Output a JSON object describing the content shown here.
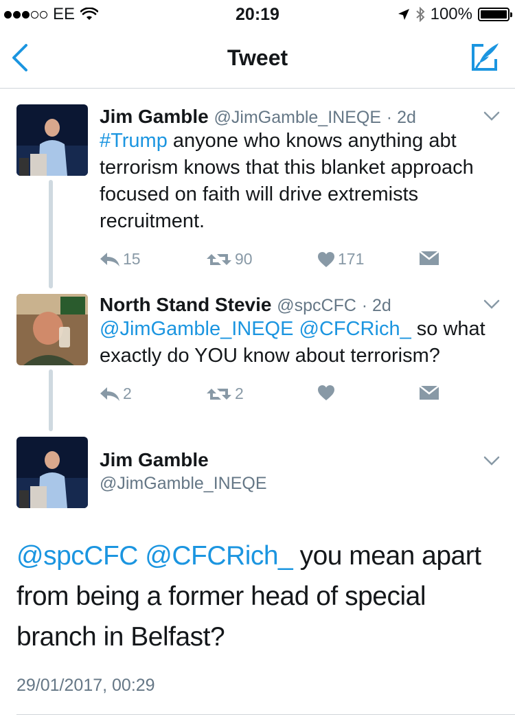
{
  "status_bar": {
    "carrier": "EE",
    "time": "20:19",
    "battery": "100%",
    "signal_bars_filled": 3,
    "signal_bars_total": 5
  },
  "nav": {
    "title": "Tweet"
  },
  "tweets": [
    {
      "name": "Jim Gamble",
      "handle": "@JimGamble_INEQE",
      "time": "· 2d",
      "text_parts": [
        {
          "text": "#Trump",
          "link": true
        },
        {
          "text": " anyone who knows anything abt terrorism knows that this blanket approach focused on faith will drive extremists recruitment.",
          "link": false
        }
      ],
      "replies": "15",
      "retweets": "90",
      "likes": "171"
    },
    {
      "name": "North Stand Stevie",
      "handle": "@spcCFC",
      "time": "· 2d",
      "text_parts": [
        {
          "text": "@JimGamble_INEQE",
          "link": true
        },
        {
          "text": " ",
          "link": false
        },
        {
          "text": "@CFCRich_",
          "link": true
        },
        {
          "text": " so what exactly do YOU know about terrorism?",
          "link": false
        }
      ],
      "replies": "2",
      "retweets": "2",
      "likes": ""
    }
  ],
  "main_tweet": {
    "name": "Jim Gamble",
    "handle": "@JimGamble_INEQE",
    "text_parts": [
      {
        "text": "@spcCFC",
        "link": true
      },
      {
        "text": " ",
        "link": false
      },
      {
        "text": "@CFCRich_",
        "link": true
      },
      {
        "text": " you mean apart from being a former head of special branch in Belfast?",
        "link": false
      }
    ],
    "timestamp": "29/01/2017, 00:29"
  },
  "colors": {
    "link": "#1b95e0",
    "secondary_text": "#657786",
    "icon_gray": "#8899a6",
    "thread_line": "#cfd9e0"
  },
  "icons": {
    "back": "chevron-left-icon",
    "compose": "compose-icon",
    "reply": "reply-icon",
    "retweet": "retweet-icon",
    "like": "heart-icon",
    "dm": "envelope-icon",
    "more": "chevron-down-icon"
  }
}
